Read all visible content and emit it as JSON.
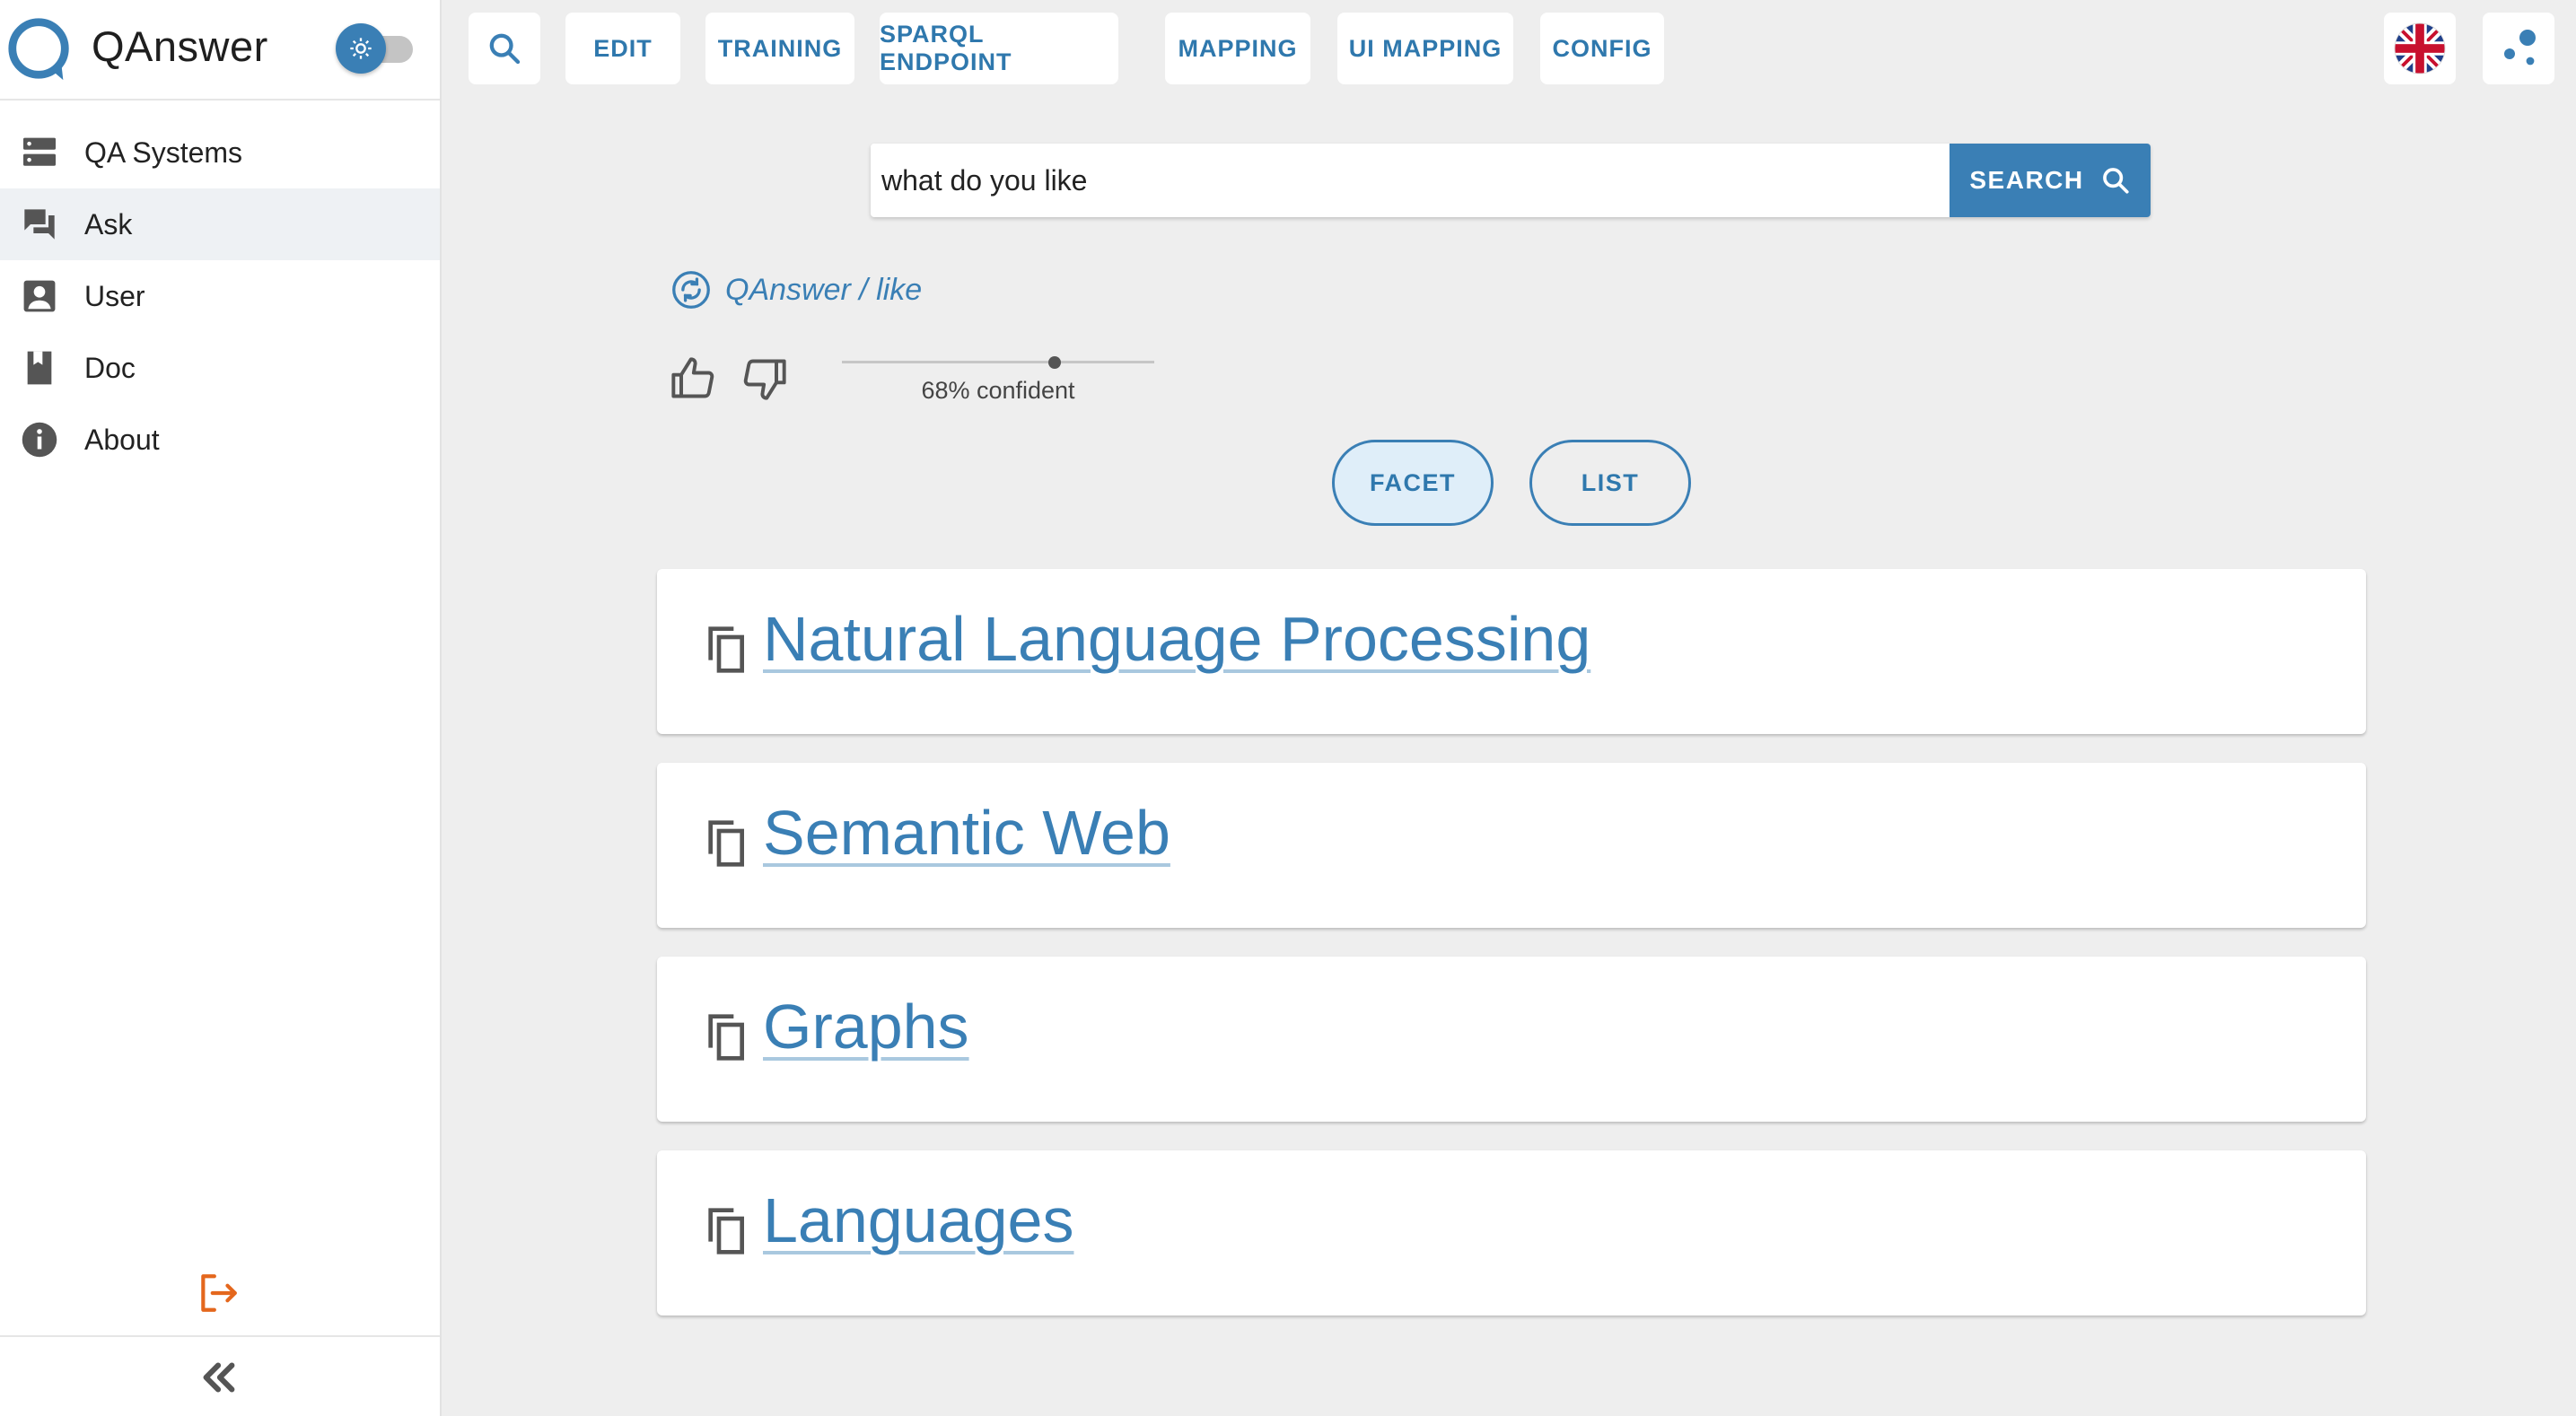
{
  "app": {
    "name": "QAnswer",
    "accent_color": "#3a7fb5",
    "logout_color": "#e4671d"
  },
  "sidebar": {
    "items": [
      {
        "label": "QA Systems",
        "icon": "database-icon",
        "active": false
      },
      {
        "label": "Ask",
        "icon": "chat-icon",
        "active": true
      },
      {
        "label": "User",
        "icon": "user-icon",
        "active": false
      },
      {
        "label": "Doc",
        "icon": "book-icon",
        "active": false
      },
      {
        "label": "About",
        "icon": "info-icon",
        "active": false
      }
    ],
    "theme_toggle_icon": "sun-icon",
    "logout_icon": "logout-icon",
    "collapse_icon": "double-chevron-left-icon"
  },
  "toolbar": {
    "search_icon": "search-icon",
    "tabs": [
      "EDIT",
      "TRAINING",
      "SPARQL ENDPOINT",
      "MAPPING",
      "UI MAPPING",
      "CONFIG"
    ],
    "language_icon": "uk-flag-icon",
    "graph_icon": "graph-dots-icon"
  },
  "search": {
    "value": "what do you like",
    "button_label": "SEARCH"
  },
  "answer": {
    "source": "QAnswer / like",
    "confidence_label": "68% confident",
    "confidence": 0.68
  },
  "views": {
    "facet_label": "FACET",
    "list_label": "LIST",
    "selected": "FACET"
  },
  "results": [
    {
      "title": "Natural Language Processing"
    },
    {
      "title": "Semantic Web"
    },
    {
      "title": "Graphs"
    },
    {
      "title": "Languages"
    }
  ]
}
